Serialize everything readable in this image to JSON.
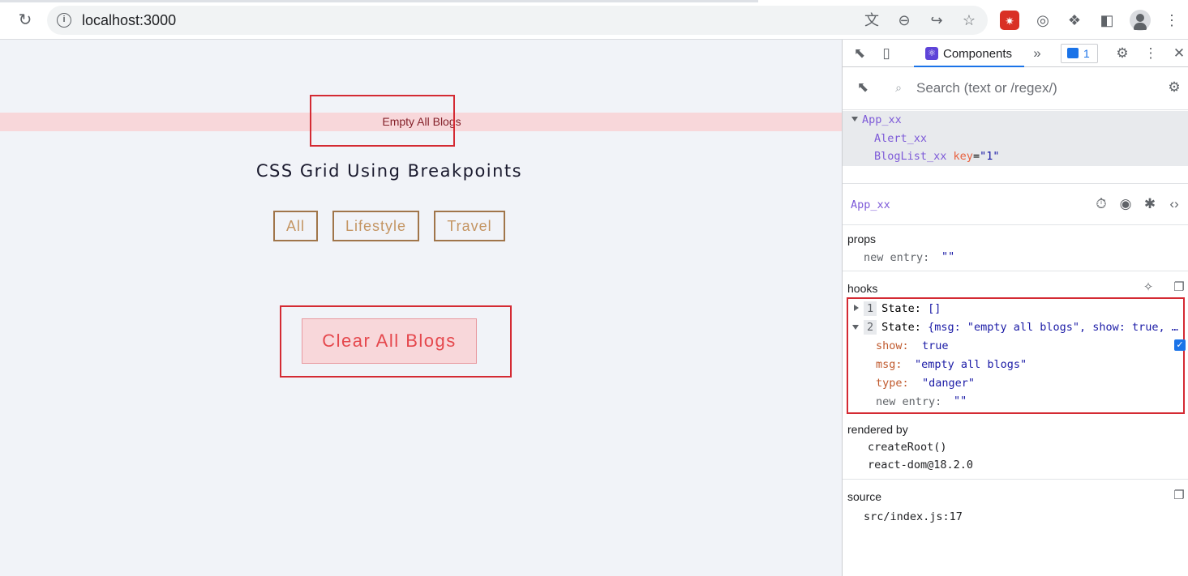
{
  "browser": {
    "url": "localhost:3000",
    "icons": [
      "reload-icon",
      "info-icon",
      "translate-icon",
      "zoom-out-icon",
      "share-icon",
      "star-icon",
      "extension-icon",
      "puzzle-icon",
      "sidepanel-icon",
      "avatar-icon",
      "more-icon"
    ]
  },
  "page": {
    "alert_text": "Empty All Blogs",
    "title": "CSS Grid Using Breakpoints",
    "filters": [
      "All",
      "Lifestyle",
      "Travel"
    ],
    "clear_button": "Clear All Blogs"
  },
  "devtools": {
    "active_tab": "Components",
    "issues_count": "1",
    "search_placeholder": "Search (text or /regex/)",
    "tree": {
      "root": "App_xx",
      "children": [
        {
          "name": "Alert_xx"
        },
        {
          "name": "BlogList_xx",
          "key_label": "key",
          "key_eq": "=",
          "key_value": "\"1\""
        }
      ]
    },
    "selected": "App_xx",
    "props": {
      "title": "props",
      "new_entry_label": "new entry:",
      "new_entry_value": "\"\""
    },
    "hooks": {
      "title": "hooks",
      "items": [
        {
          "index": "1",
          "label": "State:",
          "value": "[]"
        },
        {
          "index": "2",
          "label": "State:",
          "value": "{msg: \"empty all blogs\", show: true, …"
        }
      ],
      "expanded": [
        {
          "key": "show:",
          "value": "true"
        },
        {
          "key": "msg:",
          "value": "\"empty all blogs\""
        },
        {
          "key": "type:",
          "value": "\"danger\""
        }
      ],
      "new_entry_label": "new entry:",
      "new_entry_value": "\"\""
    },
    "rendered_by": {
      "title": "rendered by",
      "items": [
        "createRoot()",
        "react-dom@18.2.0"
      ]
    },
    "source": {
      "title": "source",
      "value": "src/index.js:17"
    }
  }
}
